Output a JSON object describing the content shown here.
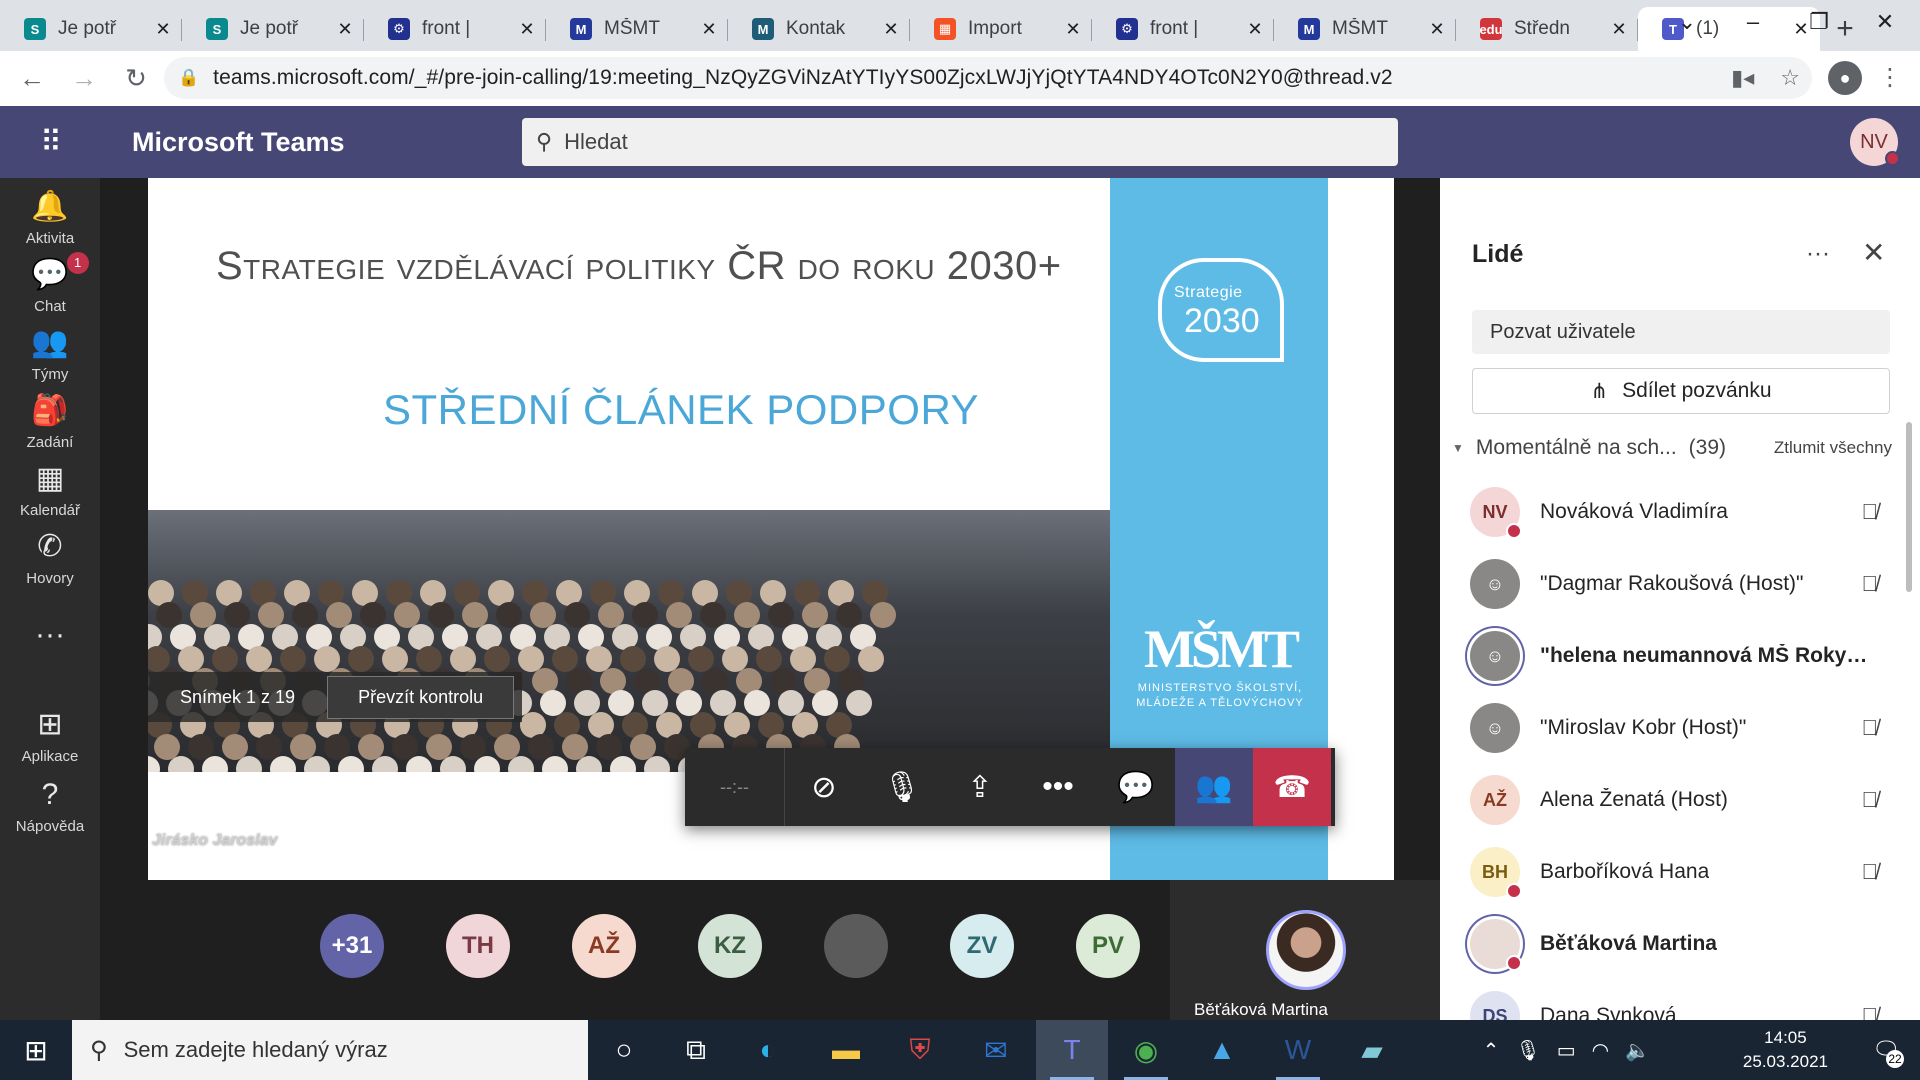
{
  "browser": {
    "tabs": [
      {
        "title": "Je potř",
        "fav": "S",
        "color": "#0a8a8f"
      },
      {
        "title": "Je potř",
        "fav": "S",
        "color": "#0a8a8f"
      },
      {
        "title": "front |",
        "fav": "⚙",
        "color": "#22308f"
      },
      {
        "title": "MŠMT",
        "fav": "M",
        "color": "#23399b"
      },
      {
        "title": "Kontak",
        "fav": "M",
        "color": "#1e5c77"
      },
      {
        "title": "Import",
        "fav": "▦",
        "color": "#f35325"
      },
      {
        "title": "front |",
        "fav": "⚙",
        "color": "#22308f"
      },
      {
        "title": "MŠMT",
        "fav": "M",
        "color": "#23399b"
      },
      {
        "title": "Středn",
        "fav": "edu",
        "color": "#d1363b"
      },
      {
        "title": "(1)",
        "fav": "T",
        "color": "#5059c9"
      }
    ],
    "url": "teams.microsoft.com/_#/pre-join-calling/19:meeting_NzQyZGViNzAtYTIyYS00ZjcxLWJjYjQtYTA4NDY4OTc0N2Y0@thread.v2"
  },
  "teams": {
    "brand": "Microsoft Teams",
    "search_placeholder": "Hledat",
    "me_initials": "NV",
    "rail": [
      {
        "label": "Aktivita",
        "icon": "bell-icon"
      },
      {
        "label": "Chat",
        "icon": "chat-icon",
        "badge": "1"
      },
      {
        "label": "Týmy",
        "icon": "teams-icon"
      },
      {
        "label": "Zadání",
        "icon": "assignments-icon"
      },
      {
        "label": "Kalendář",
        "icon": "calendar-icon"
      },
      {
        "label": "Hovory",
        "icon": "phone-icon"
      },
      {
        "label": "Aplikace",
        "icon": "apps-icon"
      },
      {
        "label": "Nápověda",
        "icon": "help-icon"
      }
    ]
  },
  "slide": {
    "title": "Strategie vzdělávací politiky ČR do roku 2030+",
    "subtitle": "STŘEDNÍ ČLÁNEK PODPORY",
    "logo_top": "Strategie",
    "logo_year": "2030",
    "ministry_mark": "MŠMT",
    "ministry_line1": "MINISTERSTVO ŠKOLSTVÍ,",
    "ministry_line2": "MLÁDEŽE A TĚLOVÝCHOVY",
    "slide_counter": "Snímek 1 z 19",
    "take_control": "Převzít kontrolu",
    "presenter": "Jirásko Jaroslav"
  },
  "callbar": {
    "timer": "--:--"
  },
  "strip": {
    "overflow": "+31",
    "avatars": [
      {
        "initials": "TH",
        "bg": "#f0d6d9",
        "fg": "#7a3a45"
      },
      {
        "initials": "AŽ",
        "bg": "#f6d9cf",
        "fg": "#8a3a22"
      },
      {
        "initials": "KZ",
        "bg": "#d3e3d6",
        "fg": "#3b5e42"
      },
      {
        "initials": "",
        "bg": "#5b5b5b",
        "fg": "#fff"
      },
      {
        "initials": "ZV",
        "bg": "#d6ecee",
        "fg": "#2f6a72"
      },
      {
        "initials": "PV",
        "bg": "#dcebd8",
        "fg": "#3e6a36"
      }
    ],
    "self_name": "Běťáková Martina"
  },
  "people": {
    "title": "Lidé",
    "invite": "Pozvat uživatele",
    "share": "Sdílet pozvánku",
    "section": "Momentálně na sch...",
    "count": "(39)",
    "mute_all": "Ztlumit všechny",
    "list": [
      {
        "initials": "NV",
        "name": "Nováková Vladimíra",
        "bg": "#f4d6d6",
        "fg": "#7a2e2e",
        "status": true,
        "muted": true,
        "bold": false
      },
      {
        "initials": "☺",
        "name": "\"Dagmar Rakoušová (Host)\"",
        "bg": "#8a8886",
        "fg": "#fff",
        "status": false,
        "muted": true,
        "bold": false
      },
      {
        "initials": "☺",
        "name": "\"helena neumannová MŠ Rokyt...",
        "bg": "#8a8886",
        "fg": "#fff",
        "status": false,
        "muted": false,
        "bold": true,
        "ring": true
      },
      {
        "initials": "☺",
        "name": "\"Miroslav Kobr (Host)\"",
        "bg": "#8a8886",
        "fg": "#fff",
        "status": false,
        "muted": true,
        "bold": false
      },
      {
        "initials": "AŽ",
        "name": "Alena Ženatá (Host)",
        "bg": "#f6d9cf",
        "fg": "#8a3a22",
        "status": false,
        "muted": true,
        "bold": false
      },
      {
        "initials": "BH",
        "name": "Barboříková Hana",
        "bg": "#fbefc7",
        "fg": "#7a5b10",
        "status": true,
        "muted": true,
        "bold": false
      },
      {
        "initials": "",
        "name": "Běťáková Martina",
        "bg": "#e9dcd6",
        "fg": "#444",
        "status": true,
        "muted": false,
        "bold": true,
        "ring": true
      },
      {
        "initials": "DS",
        "name": "Dana Synková",
        "bg": "#dfe2f1",
        "fg": "#3b4578",
        "status": false,
        "muted": true,
        "bold": false
      }
    ]
  },
  "taskbar": {
    "search": "Sem zadejte hledaný výraz",
    "time": "14:05",
    "date": "25.03.2021",
    "notifications": "22"
  }
}
